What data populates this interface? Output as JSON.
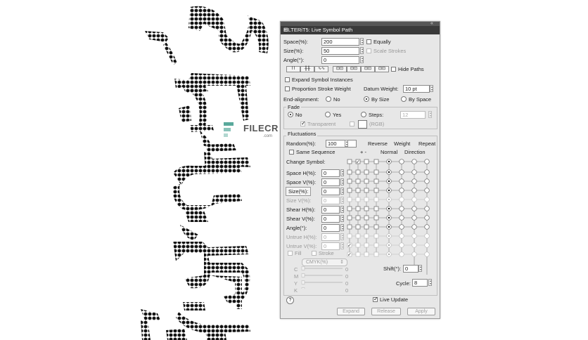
{
  "window": {
    "title": "FILTERiT5: Live Symbol Path",
    "collapse_icon": "double-chevron-icon",
    "menu_icon": "panel-menu-icon"
  },
  "top": {
    "space_label": "Space(%):",
    "space_value": "200",
    "size_label": "Size(%):",
    "size_value": "50",
    "angle_label": "Angle(°):",
    "angle_value": "0",
    "equally_label": "Equally",
    "scale_strokes_label": "Scale Strokes",
    "hide_paths_label": "Hide Paths",
    "expand_instances_label": "Expand Symbol Instances",
    "proportion_label": "Proportion Stroke Weight",
    "datum_label": "Datum Weight:",
    "datum_value": "10 pt",
    "end_alignment_label": "End-alignment:",
    "end_no": "No",
    "end_by_size": "By Size",
    "end_by_space": "By Space"
  },
  "fade": {
    "group_label": "Fade",
    "no_label": "No",
    "yes_label": "Yes",
    "steps_label": "Steps:",
    "steps_value": "12",
    "transparent_label": "Transparent",
    "rgb_label": "(RGB)"
  },
  "fluctuations": {
    "group_label": "Fluctuations",
    "random_label": "Random(%):",
    "random_value": "100",
    "reverse_label": "Reverse",
    "weight_label": "Weight",
    "repeat_label": "Repeat",
    "plus_minus_label": "+ -",
    "normal_label": "Normal",
    "direction_label": "Direction",
    "same_sequence_label": "Same Sequence",
    "change_symbol_label": "Change Symbol:",
    "rows": [
      {
        "label": "Space H(%):",
        "value": "0"
      },
      {
        "label": "Space V(%):",
        "value": "0"
      },
      {
        "label": "Size(%):",
        "value": "0"
      },
      {
        "label": "Size V(%):",
        "value": "0"
      },
      {
        "label": "Shear H(%):",
        "value": "0"
      },
      {
        "label": "Shear V(%):",
        "value": "0"
      },
      {
        "label": "Angle(°):",
        "value": "0"
      },
      {
        "label": "Untrue H(%):",
        "value": "0"
      },
      {
        "label": "Untrue V(%):",
        "value": "0"
      }
    ],
    "fill_label": "Fill",
    "stroke_label": "Stroke",
    "color_mode": "CMYK(%)",
    "channels": [
      {
        "label": "C",
        "value": "0"
      },
      {
        "label": "M",
        "value": "0"
      },
      {
        "label": "Y",
        "value": "0"
      },
      {
        "label": "K",
        "value": "0"
      }
    ],
    "shift_label": "Shift(°):",
    "shift_value": "0",
    "cycle_label": "Cycle:",
    "cycle_value": "8"
  },
  "footer": {
    "help_label": "?",
    "live_update_label": "Live Update",
    "expand_label": "Expand",
    "release_label": "Release",
    "apply_label": "Apply"
  },
  "watermark": {
    "text": "FILECR",
    "subtext": ".com"
  },
  "colors": {
    "panel_bg": "#e7e7e7",
    "titlebar": "#3a3a3a",
    "artwork": "#111111",
    "watermark_green": "#3c9a8a"
  }
}
